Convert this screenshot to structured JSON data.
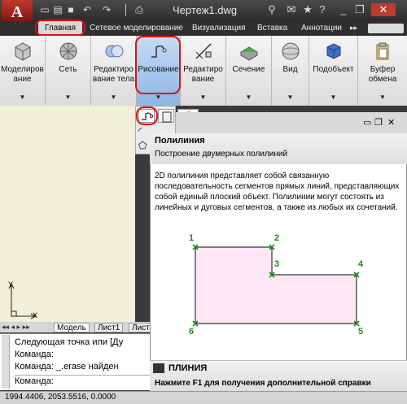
{
  "app": {
    "title": "Чертеж1.dwg",
    "logo_letter": "A"
  },
  "tabs": [
    "Главная",
    "Сетевое моделирование",
    "Визуализация",
    "Вставка",
    "Аннотации"
  ],
  "ribbon": {
    "modeling": "Моделиров\nание",
    "mesh": "Сеть",
    "solid_edit": "Редактиро\nвание тела",
    "draw": "Рисование",
    "modify": "Редактиро\nвание",
    "section": "Сечение",
    "view": "Вид",
    "subobject": "Подобъект",
    "clipboard": "Буфер\nобмена"
  },
  "layout_tabs": [
    "Модель",
    "Лист1",
    "Лист"
  ],
  "command_lines": [
    "Следующая точка или [Ду",
    "Команда:",
    "Команда:  _.erase найден",
    "Команда:"
  ],
  "status": {
    "coords": "1994.4406, 2053.5516, 0.0000"
  },
  "axes": {
    "y": "Y",
    "x": "X"
  },
  "tooltip": {
    "title": "Полилиния",
    "subtitle": "Построение двумерных полилиний",
    "body": "2D полилиния представляет собой связанную последовательность сегментов прямых линий, представляющих собой единый плоский объект. Полилинии могут состоять из линейных и дуговых сегментов, а также из любых их сочетаний.",
    "command": "ПЛИНИЯ",
    "help": "Нажмите F1 для получения дополнительной справки",
    "points": [
      "1",
      "2",
      "3",
      "4",
      "5",
      "6"
    ]
  },
  "colors": {
    "highlight_oval": "#e01010",
    "polyline_fill": "#fbe8f4",
    "point_marker": "#1a8a1a"
  }
}
